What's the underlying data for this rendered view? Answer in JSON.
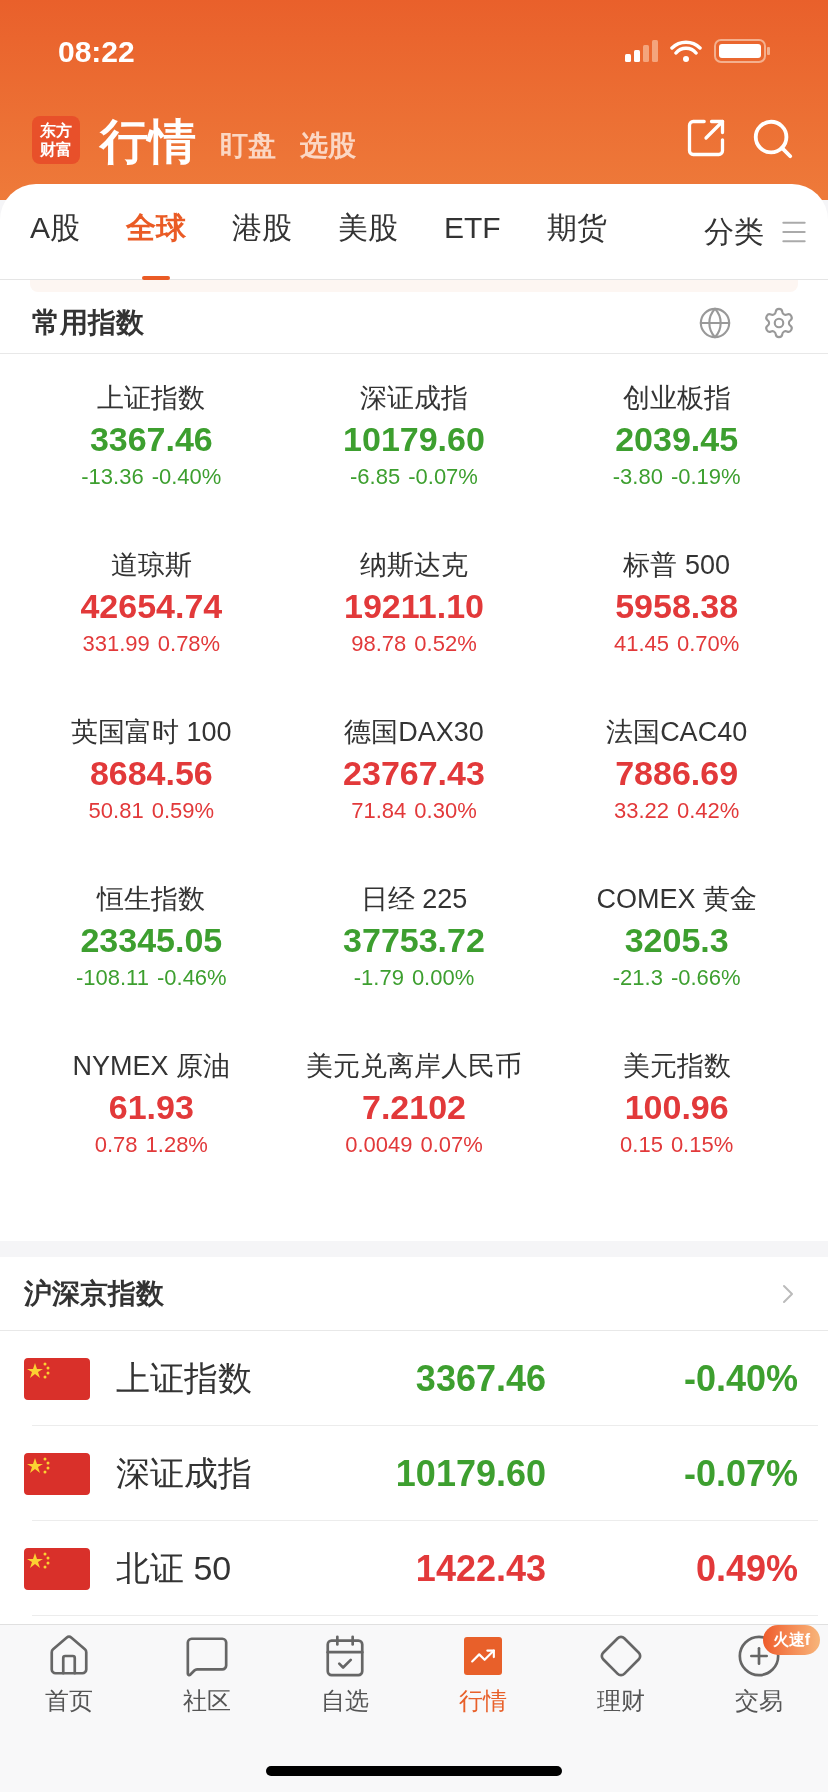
{
  "status_bar": {
    "time": "08:22"
  },
  "header": {
    "logo": "东方财富",
    "tabs": [
      {
        "label": "行情",
        "selected": true
      },
      {
        "label": "盯盘",
        "selected": false
      },
      {
        "label": "选股",
        "selected": false
      }
    ]
  },
  "market_tabs": [
    {
      "label": "A股",
      "selected": false
    },
    {
      "label": "全球",
      "selected": true
    },
    {
      "label": "港股",
      "selected": false
    },
    {
      "label": "美股",
      "selected": false
    },
    {
      "label": "ETF",
      "selected": false
    },
    {
      "label": "期货",
      "selected": false
    }
  ],
  "category_button": "分类",
  "common_indices": {
    "title": "常用指数",
    "items": [
      {
        "name": "上证指数",
        "value": "3367.46",
        "change": "-13.36",
        "pct": "-0.40%",
        "kind": "down"
      },
      {
        "name": "深证成指",
        "value": "10179.60",
        "change": "-6.85",
        "pct": "-0.07%",
        "kind": "down"
      },
      {
        "name": "创业板指",
        "value": "2039.45",
        "change": "-3.80",
        "pct": "-0.19%",
        "kind": "down"
      },
      {
        "name": "道琼斯",
        "value": "42654.74",
        "change": "331.99",
        "pct": "0.78%",
        "kind": "up"
      },
      {
        "name": "纳斯达克",
        "value": "19211.10",
        "change": "98.78",
        "pct": "0.52%",
        "kind": "up"
      },
      {
        "name": "标普 500",
        "value": "5958.38",
        "change": "41.45",
        "pct": "0.70%",
        "kind": "up"
      },
      {
        "name": "英国富时 100",
        "value": "8684.56",
        "change": "50.81",
        "pct": "0.59%",
        "kind": "up"
      },
      {
        "name": "德国DAX30",
        "value": "23767.43",
        "change": "71.84",
        "pct": "0.30%",
        "kind": "up"
      },
      {
        "name": "法国CAC40",
        "value": "7886.69",
        "change": "33.22",
        "pct": "0.42%",
        "kind": "up"
      },
      {
        "name": "恒生指数",
        "value": "23345.05",
        "change": "-108.11",
        "pct": "-0.46%",
        "kind": "down"
      },
      {
        "name": "日经 225",
        "value": "37753.72",
        "change": "-1.79",
        "pct": "0.00%",
        "kind": "down"
      },
      {
        "name": "COMEX 黄金",
        "value": "3205.3",
        "change": "-21.3",
        "pct": "-0.66%",
        "kind": "down"
      },
      {
        "name": "NYMEX 原油",
        "value": "61.93",
        "change": "0.78",
        "pct": "1.28%",
        "kind": "up"
      },
      {
        "name": "美元兑离岸人民币",
        "value": "7.2102",
        "change": "0.0049",
        "pct": "0.07%",
        "kind": "up"
      },
      {
        "name": "美元指数",
        "value": "100.96",
        "change": "0.15",
        "pct": "0.15%",
        "kind": "up"
      }
    ]
  },
  "hs_indices": {
    "title": "沪深京指数",
    "rows": [
      {
        "name": "上证指数",
        "value": "3367.46",
        "pct": "-0.40%",
        "kind": "down"
      },
      {
        "name": "深证成指",
        "value": "10179.60",
        "pct": "-0.07%",
        "kind": "down"
      },
      {
        "name": "北证 50",
        "value": "1422.43",
        "pct": "0.49%",
        "kind": "up"
      }
    ]
  },
  "bottom_nav": [
    {
      "label": "首页",
      "selected": false
    },
    {
      "label": "社区",
      "selected": false
    },
    {
      "label": "自选",
      "selected": false
    },
    {
      "label": "行情",
      "selected": true
    },
    {
      "label": "理财",
      "selected": false
    },
    {
      "label": "交易",
      "selected": false
    }
  ],
  "trade_badge": "火速f"
}
